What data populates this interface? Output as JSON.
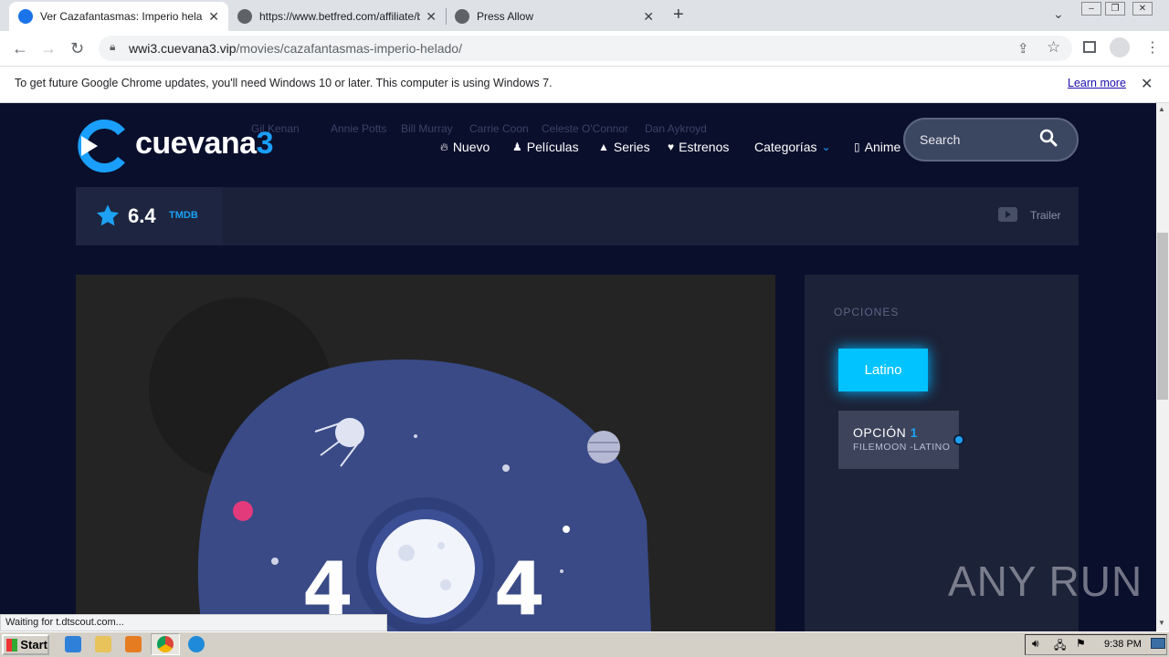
{
  "browser": {
    "tabs": [
      {
        "title": "Ver Cazafantasmas: Imperio helado",
        "active": true
      },
      {
        "title": "https://www.betfred.com/affiliate/b",
        "active": false
      },
      {
        "title": "Press Allow",
        "active": false
      }
    ],
    "new_tab_symbol": "+",
    "url_domain": "wwi3.cuevana3.vip",
    "url_path": "/movies/cazafantasmas-imperio-helado/"
  },
  "infobar": {
    "message": "To get future Google Chrome updates, you'll need Windows 10 or later. This computer is using Windows 7.",
    "learn_more": "Learn more"
  },
  "site": {
    "logo_text": "cuevana",
    "logo_number": "3",
    "cast": [
      "Gil Kenan",
      "Annie Potts",
      "Bill Murray",
      "Carrie Coon",
      "Celeste O'Connor",
      "Dan Aykroyd"
    ],
    "nav": [
      {
        "label": "Nuevo",
        "icon": "fire-icon"
      },
      {
        "label": "Películas",
        "icon": "person-icon"
      },
      {
        "label": "Series",
        "icon": "triangle-icon"
      },
      {
        "label": "Estrenos",
        "icon": "heart-icon"
      },
      {
        "label": "Categorías",
        "icon": "chevron-down-icon"
      },
      {
        "label": "Anime",
        "icon": "box-icon"
      }
    ],
    "search_placeholder": "Search"
  },
  "rating": {
    "value": "6.4",
    "source": "TMDB",
    "trailer_label": "Trailer"
  },
  "player": {
    "error_code_left": "4",
    "error_code_right": "4"
  },
  "options": {
    "heading": "OPCIONES",
    "language_button": "Latino",
    "option_title": "OPCIÓN",
    "option_number": "1",
    "option_server": "FILEMOON -LATINO"
  },
  "status_text": "Waiting for t.dtscout.com...",
  "watermark": "ANY RUN",
  "taskbar": {
    "start_label": "Start",
    "clock": "9:38 PM"
  },
  "colors": {
    "page_bg": "#0a0f2c",
    "accent": "#00c3ff",
    "logo_blue": "#1a9fff"
  }
}
